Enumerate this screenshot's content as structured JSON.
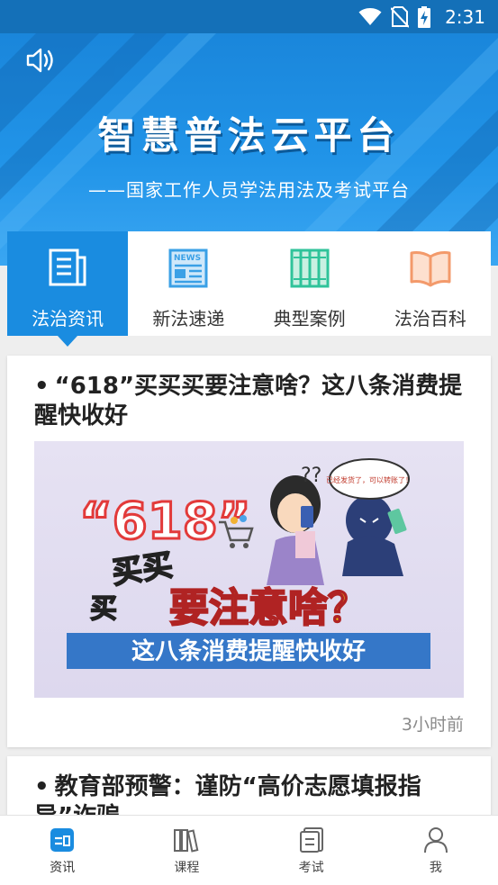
{
  "status_bar": {
    "time": "2:31",
    "icons": [
      "wifi-icon",
      "no-sim-icon",
      "battery-charging-icon"
    ]
  },
  "banner": {
    "title": "智慧普法云平台",
    "subtitle": "——国家工作人员学法用法及考试平台",
    "icon": "speaker-icon"
  },
  "categories": [
    {
      "label": "法治资讯",
      "icon": "news-list-icon",
      "active": true
    },
    {
      "label": "新法速递",
      "icon": "newspaper-icon",
      "active": false
    },
    {
      "label": "典型案例",
      "icon": "case-files-icon",
      "active": false
    },
    {
      "label": "法治百科",
      "icon": "open-book-icon",
      "active": false
    }
  ],
  "news": [
    {
      "bullet": "•",
      "title": "“618”买买买要注意啥？这八条消费提醒快收好",
      "time": "3小时前",
      "image": {
        "number": "“618”",
        "line1": "买买",
        "line1b": "买",
        "line2": "要注意啥？",
        "line3": "这八条消费提醒快收好",
        "bubble": "已经发货了，可以转账了！",
        "question": "??"
      }
    },
    {
      "bullet": "•",
      "title": "教育部预警：谨防“高价志愿填报指导”诈骗"
    }
  ],
  "bottom_nav": [
    {
      "label": "资讯",
      "icon": "news-tab-icon",
      "active": true
    },
    {
      "label": "课程",
      "icon": "books-icon",
      "active": false
    },
    {
      "label": "考试",
      "icon": "exam-paper-icon",
      "active": false
    },
    {
      "label": "我",
      "icon": "user-icon",
      "active": false
    }
  ],
  "colors": {
    "primary": "#1a8ce0",
    "status_bar": "#1470b8",
    "tab_active_bg": "#1a8ce0",
    "news_icon_green": "#2fc39a",
    "news_icon_orange": "#f39a6b",
    "news_icon_blue": "#3aa0e6"
  }
}
